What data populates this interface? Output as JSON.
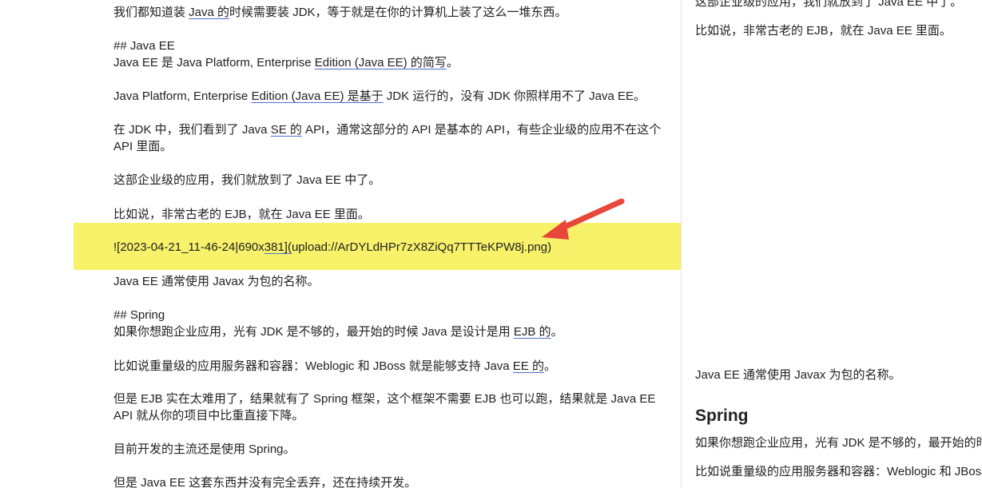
{
  "editor": {
    "lines": [
      {
        "t1": "我们都知道装 ",
        "u1": "Java 的",
        "t2": "时候需要装 JDK，等于就是在你的计算机上装了这么一堆东西。"
      },
      {
        "text": "## Java EE"
      },
      {
        "t1": "Java EE 是 Java Platform, Enterprise ",
        "u1": "Edition (Java EE) 的简写",
        "t2": "。"
      },
      {
        "t1": "Java Platform, Enterprise ",
        "u1": "Edition (Java EE) 是基于",
        "t2": " JDK 运行的，没有 JDK 你照样用不了 Java EE。"
      },
      {
        "t1": "在 JDK 中，我们看到了 Java ",
        "u1": "SE 的",
        "t2": " API，通常这部分的 API 是基本的 API，有些企业级的应用不在这个"
      },
      {
        "text": "API 里面。"
      },
      {
        "text": "这部企业级的应用，我们就放到了 Java EE 中了。"
      },
      {
        "text": "比如说，非常古老的 EJB，就在 Java EE 里面。"
      },
      {
        "t1": "![2023-04-21_11-46-24|690x",
        "u1": "381](",
        "t2": "upload://ArDYLdHPr7zX8ZiQq7TTTeKPW8j.png)"
      },
      {
        "text": "Java EE 通常使用 Javax 为包的名称。"
      },
      {
        "text": "## Spring"
      },
      {
        "t1": "如果你想跑企业应用，光有 JDK 是不够的，最开始的时候 Java 是设计是用 ",
        "u1": "EJB 的",
        "t2": "。"
      },
      {
        "t1": "比如说重量级的应用服务器和容器：Weblogic 和 JBoss 就是能够支持 Java ",
        "u1": "EE 的",
        "t2": "。"
      },
      {
        "text": "但是 EJB 实在太难用了，结果就有了 Spring 框架，这个框架不需要 EJB 也可以跑，结果就是 Java EE"
      },
      {
        "text": "API 就从你的项目中比重直接下降。"
      },
      {
        "text": "目前开发的主流还是使用 Spring。"
      },
      {
        "text": "但是 Java EE 这套东西并没有完全丢弃，还在持续开发。"
      }
    ]
  },
  "preview": {
    "top_line": "这部企业级的应用，我们就放到了 Java EE 中了。",
    "ejb_line": "比如说，非常古老的 EJB，就在 Java EE 里面。",
    "javax_line": "Java EE 通常使用 Javax 为包的名称。",
    "spring_heading": "Spring",
    "spring_line1": "如果你想跑企业应用，光有 JDK 是不够的，最开始的时候 Java",
    "spring_line2": "比如说重量级的应用服务器和容器：Weblogic 和 JBoss 就是能"
  },
  "colors": {
    "highlight": "#f8f16a",
    "arrow": "#e8463a",
    "link_underline": "#4a6fd1"
  }
}
